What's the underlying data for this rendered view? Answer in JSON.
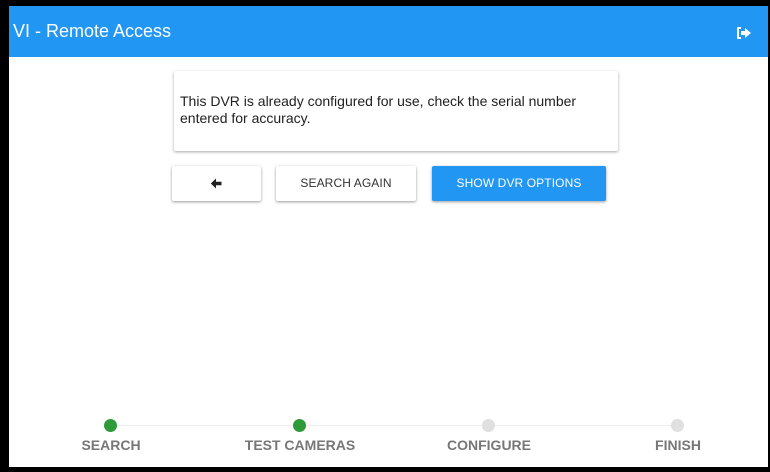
{
  "app": {
    "title": "VI - Remote Access",
    "logout_icon": "logout-icon"
  },
  "message": {
    "text": "This DVR is already configured for use, check the serial number entered for accuracy."
  },
  "actions": {
    "back_icon": "arrow-left-icon",
    "search_again_label": "SEARCH AGAIN",
    "show_options_label": "SHOW DVR OPTIONS"
  },
  "colors": {
    "primary": "#2196f3",
    "step_complete": "#2e9a3a",
    "step_pending": "#e0e0e0"
  },
  "stepper": {
    "steps": [
      {
        "label": "SEARCH",
        "status": "complete"
      },
      {
        "label": "TEST CAMERAS",
        "status": "complete"
      },
      {
        "label": "CONFIGURE",
        "status": "pending"
      },
      {
        "label": "FINISH",
        "status": "pending"
      }
    ]
  }
}
